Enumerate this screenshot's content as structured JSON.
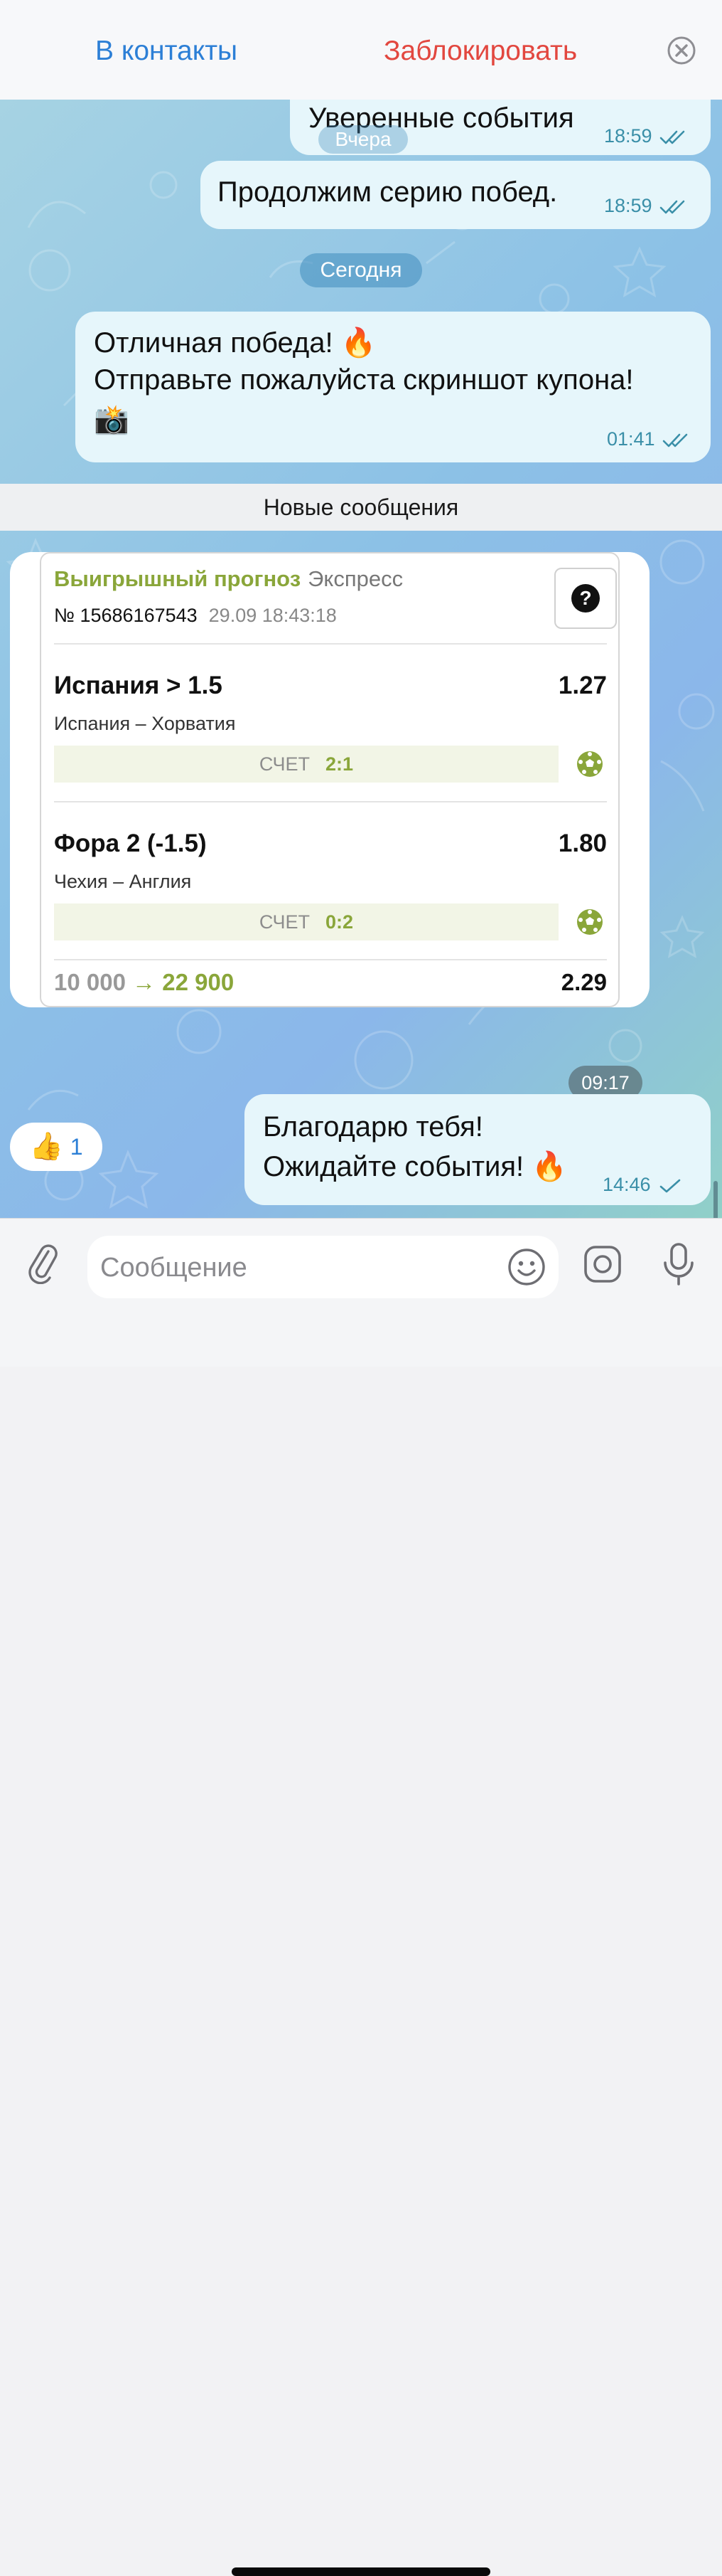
{
  "header": {
    "add_contact": "В контакты",
    "block": "Заблокировать",
    "close_icon": "close-circle-icon"
  },
  "messages": {
    "m1": {
      "text": "Уверенные события",
      "time": "18:59",
      "status": "read"
    },
    "date_yesterday": "Вчера",
    "m2": {
      "text": "Продолжим серию побед.",
      "time": "18:59",
      "status": "read"
    },
    "date_today": "Сегодня",
    "m3": {
      "line1": "Отличная победа! 🔥",
      "line2": "Отправьте пожалуйста скриншот купона!",
      "line3": "📸",
      "time": "01:41",
      "status": "read"
    },
    "new_messages_label": "Новые сообщения",
    "photo": {
      "time": "09:17",
      "coupon": {
        "brand": "Выигрышный прогноз",
        "bet_type": "Экспресс",
        "number": "№ 15686167543",
        "datetime": "29.09 18:43:18",
        "help_symbol": "?",
        "bets": [
          {
            "pick": "Испания > 1.5",
            "odds": "1.27",
            "teams": "Испания – Хорватия",
            "score_label": "СЧЕТ",
            "score": "2:1"
          },
          {
            "pick": "Фора 2 (-1.5)",
            "odds": "1.80",
            "teams": "Чехия – Англия",
            "score_label": "СЧЕТ",
            "score": "0:2"
          }
        ],
        "stake": "10 000",
        "arrow": "→",
        "payout": "22 900",
        "total_odds": "2.29"
      }
    },
    "reaction": {
      "emoji": "👍",
      "count": "1"
    },
    "m4": {
      "line1": "Благодарю тебя!",
      "line2": "Ожидайте события! 🔥",
      "time": "14:46",
      "status": "sent"
    }
  },
  "input": {
    "placeholder": "Сообщение",
    "value": "",
    "icons": [
      "paperclip-icon",
      "emoji-icon",
      "sticker-icon",
      "microphone-icon"
    ]
  },
  "colors": {
    "accent": "#2c7fd6",
    "danger": "#e2473f",
    "bubble": "#e6f6fb",
    "brand_green": "#8aa63a"
  }
}
